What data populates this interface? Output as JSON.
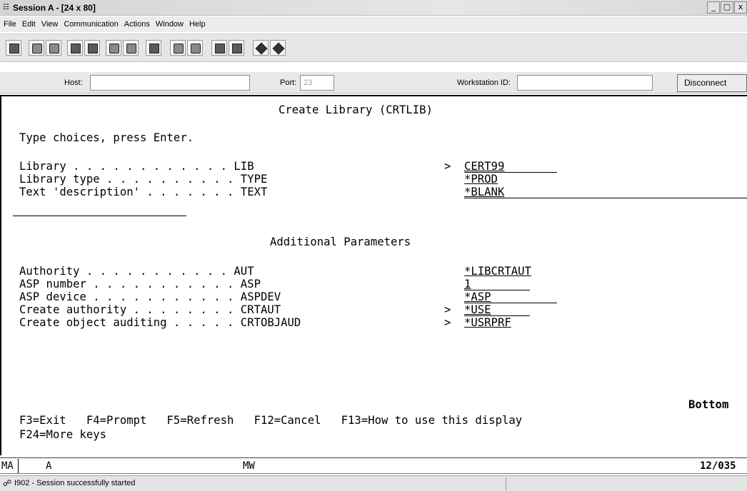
{
  "window": {
    "title": "Session A - [24 x 80]",
    "buttons": [
      "_",
      "□",
      "x"
    ]
  },
  "menubar": [
    "File",
    "Edit",
    "View",
    "Communication",
    "Actions",
    "Window",
    "Help"
  ],
  "toolbar": {
    "icons": [
      "print-screen",
      "copy",
      "paste",
      "send",
      "receive",
      "record",
      "play",
      "display",
      "start-macro",
      "stop-macro",
      "macro-file",
      "record-macro",
      "palette",
      "edit"
    ]
  },
  "hostbar": {
    "host_label": "Host:",
    "host_value": "",
    "port_label": "Port:",
    "port_value": "23",
    "ws_label": "Workstation ID:",
    "ws_value": "",
    "disconnect_label": "Disconnect"
  },
  "screen": {
    "title": "Create Library (CRTLIB)",
    "instruction": "Type choices, press Enter.",
    "section": "Additional Parameters",
    "bottom": "Bottom",
    "params": [
      {
        "dots": "Library . . . . . . . . . . . . LIB",
        "arrow": ">",
        "value": "CERT99"
      },
      {
        "dots": "Library type . . . . . . . . . . TYPE",
        "arrow": "",
        "value": "*PROD"
      },
      {
        "dots": "Text 'description' . . . . . . . TEXT",
        "arrow": "",
        "value": "*BLANK"
      },
      {
        "dots": "Authority . . . . . . . . . . . AUT",
        "arrow": "",
        "value": "*LIBCRTAUT"
      },
      {
        "dots": "ASP number . . . . . . . . . . . ASP",
        "arrow": "",
        "value": "1"
      },
      {
        "dots": "ASP device . . . . . . . . . . . ASPDEV",
        "arrow": "",
        "value": "*ASP"
      },
      {
        "dots": "Create authority . . . . . . . . CRTAUT",
        "arrow": ">",
        "value": "*USE"
      },
      {
        "dots": "Create object auditing . . . . . CRTOBJAUD",
        "arrow": ">",
        "value": "*USRPRF"
      }
    ],
    "fkeys_line1": "F3=Exit   F4=Prompt   F5=Refresh   F12=Cancel   F13=How to use this display",
    "fkeys_line2": "F24=More keys"
  },
  "oia": {
    "ma": "MA",
    "mode": "A",
    "mw": "MW",
    "position": "12/035"
  },
  "status": {
    "icon": "session-icon",
    "message": "I902 - Session successfully started"
  }
}
